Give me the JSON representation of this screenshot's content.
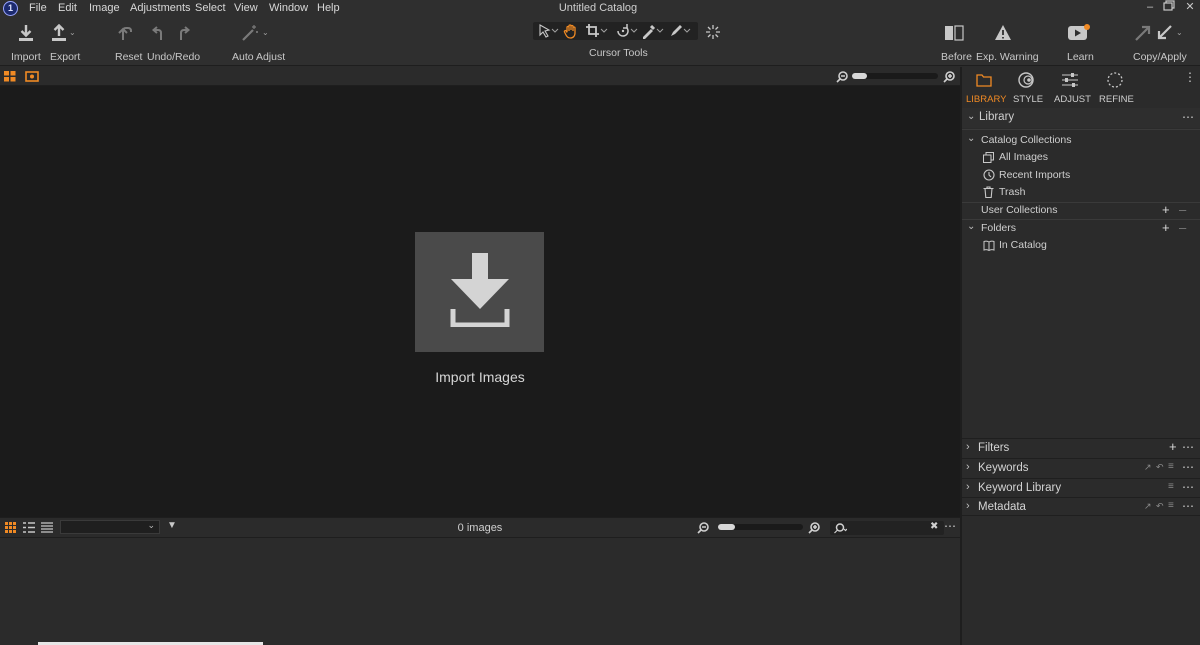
{
  "window": {
    "title": "Untitled Catalog"
  },
  "menu": [
    "File",
    "Edit",
    "Image",
    "Adjustments",
    "Select",
    "View",
    "Window",
    "Help"
  ],
  "toolbar": {
    "import": "Import",
    "export": "Export",
    "reset": "Reset",
    "undo_redo": "Undo/Redo",
    "auto_adjust": "Auto Adjust",
    "cursor_tools": "Cursor Tools",
    "before": "Before",
    "exp_warning": "Exp. Warning",
    "learn": "Learn",
    "copy_apply": "Copy/Apply"
  },
  "viewer": {
    "import_label": "Import Images"
  },
  "browser": {
    "image_count": "0 images",
    "search_placeholder": ""
  },
  "right_panel": {
    "tabs": [
      "LIBRARY",
      "STYLE",
      "ADJUST",
      "REFINE"
    ],
    "active_tab": "LIBRARY",
    "library": {
      "title": "Library",
      "catalog_collections": "Catalog Collections",
      "items": [
        "All Images",
        "Recent Imports",
        "Trash"
      ],
      "user_collections": "User Collections",
      "folders": "Folders",
      "folder_items": [
        "In Catalog"
      ]
    },
    "tools": [
      "Filters",
      "Keywords",
      "Keyword Library",
      "Metadata"
    ]
  },
  "colors": {
    "accent": "#f08a24",
    "background": "#1b1b1b",
    "panel": "#2b2b2b"
  }
}
